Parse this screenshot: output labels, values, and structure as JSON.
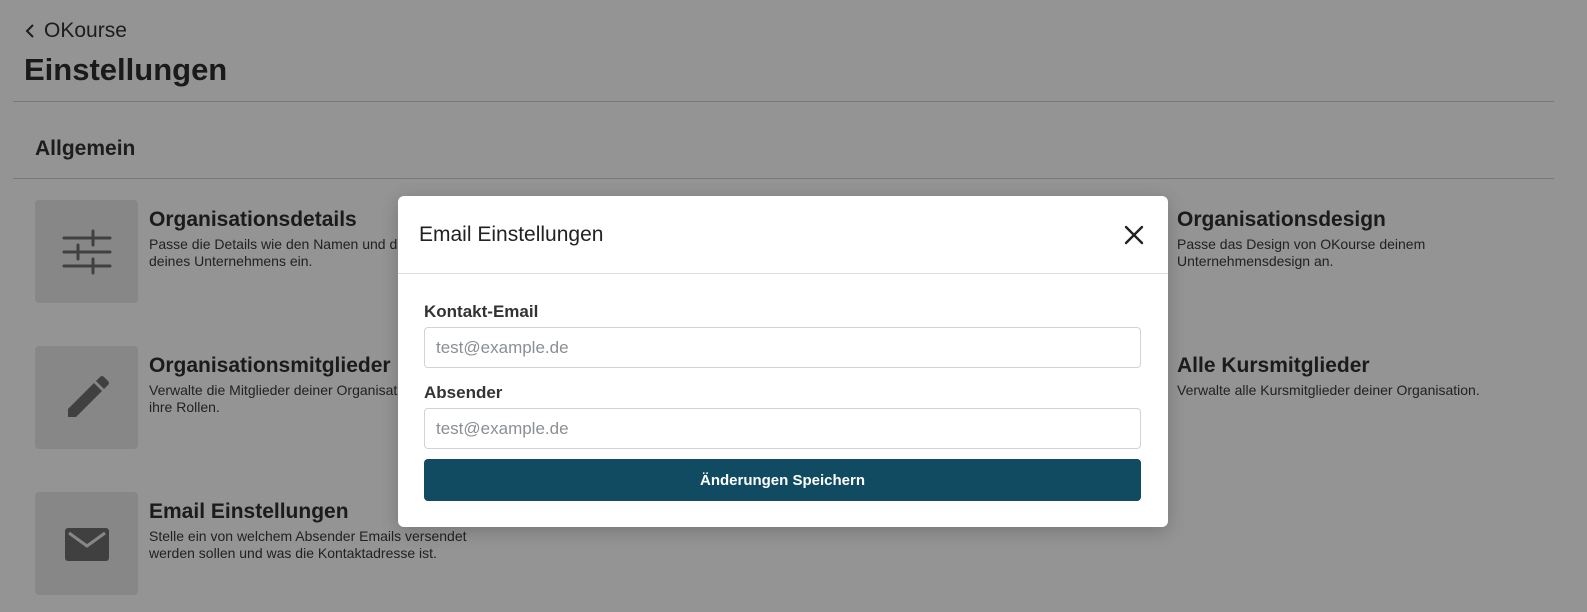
{
  "header": {
    "back_label": "OKourse",
    "title": "Einstellungen"
  },
  "section": {
    "title": "Allgemein"
  },
  "cards": [
    {
      "title": "Organisationsdetails",
      "desc": "Passe die Details wie den Namen und das Logo deines Unternehmens ein.",
      "icon": "sliders-icon"
    },
    {
      "title": "Organisationsdesign",
      "desc": "Passe das Design von OKourse deinem Unternehmensdesign an.",
      "icon": "palette-icon"
    },
    {
      "title": "Organisationsmitglieder",
      "desc": "Verwalte die Mitglieder deiner Organisation und ihre Rollen.",
      "icon": "pencil-icon"
    },
    {
      "title": "Alle Kursmitglieder",
      "desc": "Verwalte alle Kursmitglieder deiner Organisation.",
      "icon": "users-icon"
    },
    {
      "title": "Email Einstellungen",
      "desc": "Stelle ein von welchem Absender Emails versendet werden sollen und was die Kontaktadresse ist.",
      "icon": "envelope-icon"
    }
  ],
  "modal": {
    "title": "Email Einstellungen",
    "contact_label": "Kontakt-Email",
    "contact_placeholder": "test@example.de",
    "contact_value": "",
    "sender_label": "Absender",
    "sender_placeholder": "test@example.de",
    "sender_value": "",
    "save_label": "Änderungen Speichern"
  },
  "colors": {
    "primary": "#104b61",
    "overlay": "rgba(0,0,0,0.42)",
    "tile": "#e9e9e9"
  }
}
